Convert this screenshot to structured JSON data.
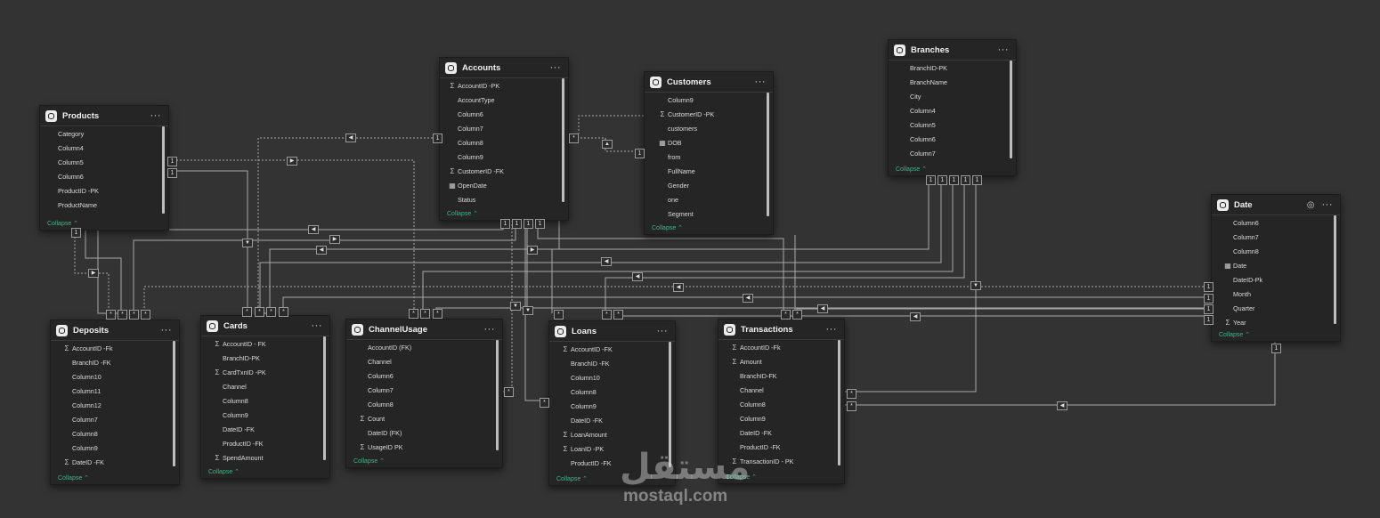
{
  "collapse_label": "Collapse ⌃",
  "tables": [
    {
      "id": "products",
      "title": "Products",
      "rows": [
        {
          "text": "Category"
        },
        {
          "text": "Column4"
        },
        {
          "text": "Column5"
        },
        {
          "text": "Column6"
        },
        {
          "text": "ProductID -PK"
        },
        {
          "text": "ProductName"
        }
      ]
    },
    {
      "id": "accounts",
      "title": "Accounts",
      "rows": [
        {
          "glyph": "sum",
          "text": "AccountID -PK"
        },
        {
          "text": "AccountType"
        },
        {
          "text": "Column6"
        },
        {
          "text": "Column7"
        },
        {
          "text": "Column8"
        },
        {
          "text": "Column9"
        },
        {
          "glyph": "sum",
          "text": "CustomerID -FK"
        },
        {
          "glyph": "cal",
          "text": "OpenDate"
        },
        {
          "text": "Status"
        }
      ]
    },
    {
      "id": "customers",
      "title": "Customers",
      "rows": [
        {
          "text": "Column9"
        },
        {
          "glyph": "sum",
          "text": "CustomerID -PK"
        },
        {
          "text": "customers"
        },
        {
          "glyph": "cal",
          "text": "DOB"
        },
        {
          "text": "from"
        },
        {
          "text": "FullName"
        },
        {
          "text": "Gender"
        },
        {
          "text": "one"
        },
        {
          "text": "Segment"
        }
      ]
    },
    {
      "id": "branches",
      "title": "Branches",
      "rows": [
        {
          "text": "BranchID-PK"
        },
        {
          "text": "BranchName"
        },
        {
          "text": "City"
        },
        {
          "text": "Column4"
        },
        {
          "text": "Column5"
        },
        {
          "text": "Column6"
        },
        {
          "text": "Column7"
        }
      ]
    },
    {
      "id": "date",
      "title": "Date",
      "eye": true,
      "rows": [
        {
          "text": "Column6"
        },
        {
          "text": "Column7"
        },
        {
          "text": "Column8"
        },
        {
          "glyph": "cal",
          "text": "Date"
        },
        {
          "text": "DateID-Pk"
        },
        {
          "text": "Month"
        },
        {
          "text": "Quarter"
        },
        {
          "glyph": "sum",
          "text": "Year"
        }
      ]
    },
    {
      "id": "deposits",
      "title": "Deposits",
      "rows": [
        {
          "glyph": "sum",
          "text": "AccountID -Fk"
        },
        {
          "text": "BranchID -FK"
        },
        {
          "text": "Column10"
        },
        {
          "text": "Column11"
        },
        {
          "text": "Column12"
        },
        {
          "text": "Column7"
        },
        {
          "text": "Column8"
        },
        {
          "text": "Column9"
        },
        {
          "glyph": "sum",
          "text": "DateID -FK"
        }
      ]
    },
    {
      "id": "cards",
      "title": "Cards",
      "rows": [
        {
          "glyph": "sum",
          "text": "AccountID - FK"
        },
        {
          "text": "BranchID-PK"
        },
        {
          "glyph": "sum",
          "text": "CardTxnID -PK"
        },
        {
          "text": "Channel"
        },
        {
          "text": "Column8"
        },
        {
          "text": "Column9"
        },
        {
          "text": "DateID -FK"
        },
        {
          "text": "ProductID -FK"
        },
        {
          "glyph": "sum",
          "text": "SpendAmount"
        }
      ]
    },
    {
      "id": "channelusage",
      "title": "ChannelUsage",
      "rows": [
        {
          "text": "AccountID (FK)"
        },
        {
          "text": "Channel"
        },
        {
          "text": "Column6"
        },
        {
          "text": "Column7"
        },
        {
          "text": "Column8"
        },
        {
          "glyph": "sum",
          "text": "Count"
        },
        {
          "text": "DateID (FK)"
        },
        {
          "glyph": "sum",
          "text": "UsageID PK"
        }
      ]
    },
    {
      "id": "loans",
      "title": "Loans",
      "rows": [
        {
          "glyph": "sum",
          "text": "AccountID -FK"
        },
        {
          "text": "BranchID -FK"
        },
        {
          "text": "Column10"
        },
        {
          "text": "Column8"
        },
        {
          "text": "Column9"
        },
        {
          "text": "DateID -FK"
        },
        {
          "glyph": "sum",
          "text": "LoanAmount"
        },
        {
          "glyph": "sum",
          "text": "LoanID -PK"
        },
        {
          "text": "ProductID -FK"
        }
      ]
    },
    {
      "id": "transactions",
      "title": "Transactions",
      "rows": [
        {
          "glyph": "sum",
          "text": "AccountID -Fk"
        },
        {
          "glyph": "sum",
          "text": "Amount"
        },
        {
          "text": "BranchID-FK"
        },
        {
          "text": "Channel"
        },
        {
          "text": "Column8"
        },
        {
          "text": "Column9"
        },
        {
          "text": "DateID -FK"
        },
        {
          "text": "ProductID -FK"
        },
        {
          "glyph": "sum",
          "text": "TransactionID - PK"
        }
      ]
    }
  ],
  "cardinality": {
    "one": "1",
    "many": "*"
  },
  "watermark": {
    "arabic": "مستقل",
    "latin": "mostaql.com"
  }
}
